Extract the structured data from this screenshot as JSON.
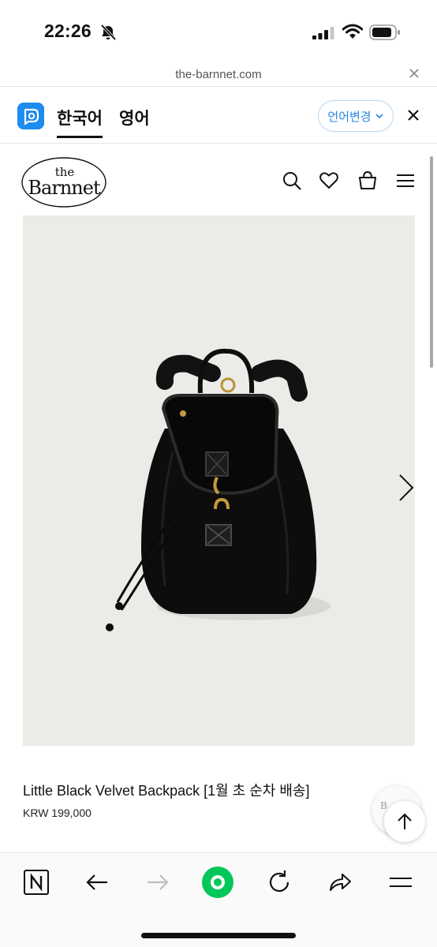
{
  "status_bar": {
    "time": "22:26"
  },
  "browser": {
    "url": "the-barnnet.com"
  },
  "translate_bar": {
    "languages": [
      "한국어",
      "영어"
    ],
    "change_label": "언어변경"
  },
  "site": {
    "logo_line1": "the",
    "logo_line2": "Barnnet"
  },
  "product": {
    "title": "Little Black Velvet Backpack [1월 초 순차 배송]",
    "price": "KRW 199,000"
  },
  "chat_bubble_text": "B"
}
